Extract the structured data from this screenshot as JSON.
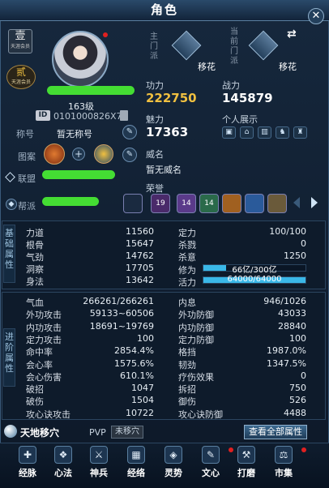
{
  "window": {
    "title": "角色",
    "close_label": "✕"
  },
  "profile": {
    "rank_badge": "壹",
    "rank_badge_sub": "天涯会员",
    "sect_badge": "贰",
    "sect_badge_sub": "天涯会员",
    "level": "163级",
    "id_tag": "ID",
    "id_value": "0101000826X7",
    "title_label": "称号",
    "title_value": "暂无称号",
    "pattern_label": "图案",
    "alliance_label": "联盟",
    "guild_label": "帮派"
  },
  "school": {
    "main_label": "主门派",
    "main_name": "移花",
    "current_label": "当前门派",
    "current_name": "移花",
    "swap_icon": "⇄"
  },
  "power": {
    "gongli_label": "功力",
    "gongli_value": "222750",
    "zhanli_label": "战力",
    "zhanli_value": "145879",
    "meili_label": "魅力",
    "meili_value": "17363",
    "showcase_label": "个人展示"
  },
  "renown": {
    "label": "威名",
    "value": "暂无威名"
  },
  "honor": {
    "label": "荣誉",
    "items": [
      "",
      "19",
      "14",
      "14",
      "",
      ""
    ]
  },
  "basic": {
    "side_label": "基础属性",
    "left": [
      {
        "name": "力道",
        "value": "11560"
      },
      {
        "name": "根骨",
        "value": "15647"
      },
      {
        "name": "气劲",
        "value": "14762"
      },
      {
        "name": "洞察",
        "value": "17705"
      },
      {
        "name": "身法",
        "value": "13642"
      }
    ],
    "right": [
      {
        "name": "定力",
        "value": "100/100"
      },
      {
        "name": "杀戮",
        "value": "0"
      },
      {
        "name": "杀意",
        "value": "1250"
      }
    ],
    "xiuwei_label": "修为",
    "xiuwei_value": "66亿/300亿",
    "xiuwei_fraction": 0.22,
    "huoli_label": "活力",
    "huoli_value": "64000/64000",
    "huoli_fraction": 1.0
  },
  "advanced": {
    "side_label": "进阶属性",
    "left": [
      {
        "name": "气血",
        "value": "266261/266261"
      },
      {
        "name": "外功攻击",
        "value": "59133~60506"
      },
      {
        "name": "内功攻击",
        "value": "18691~19769"
      },
      {
        "name": "定力攻击",
        "value": "100"
      },
      {
        "name": "命中率",
        "value": "2854.4%"
      },
      {
        "name": "会心率",
        "value": "1575.6%"
      },
      {
        "name": "会心伤害",
        "value": "610.1%"
      },
      {
        "name": "破招",
        "value": "1047"
      },
      {
        "name": "破伤",
        "value": "1504"
      },
      {
        "name": "攻心诀攻击",
        "value": "10722"
      }
    ],
    "right": [
      {
        "name": "内息",
        "value": "946/1026"
      },
      {
        "name": "外功防御",
        "value": "43033"
      },
      {
        "name": "内功防御",
        "value": "28840"
      },
      {
        "name": "定力防御",
        "value": "100"
      },
      {
        "name": "格挡",
        "value": "1987.0%"
      },
      {
        "name": "韧劲",
        "value": "1347.5%"
      },
      {
        "name": "疗伤效果",
        "value": "0"
      },
      {
        "name": "拆招",
        "value": "750"
      },
      {
        "name": "御伤",
        "value": "526"
      },
      {
        "name": "攻心诀防御",
        "value": "4488"
      }
    ]
  },
  "footer": {
    "skill_name": "天地移穴",
    "pvp_label": "PVP",
    "pvp_status": "未移穴",
    "view_all_button": "查看全部属性"
  },
  "nav": [
    {
      "label": "经脉",
      "icon": "meridian-icon",
      "glyph": "✚"
    },
    {
      "label": "心法",
      "icon": "mind-icon",
      "glyph": "❖"
    },
    {
      "label": "神兵",
      "icon": "weapon-icon",
      "glyph": "⚔"
    },
    {
      "label": "经络",
      "icon": "channel-icon",
      "glyph": "▦"
    },
    {
      "label": "灵势",
      "icon": "spirit-icon",
      "glyph": "◈"
    },
    {
      "label": "文心",
      "icon": "brush-icon",
      "glyph": "✎"
    },
    {
      "label": "打磨",
      "icon": "hammer-icon",
      "glyph": "⚒"
    },
    {
      "label": "市集",
      "icon": "market-icon",
      "glyph": "⚖"
    }
  ]
}
